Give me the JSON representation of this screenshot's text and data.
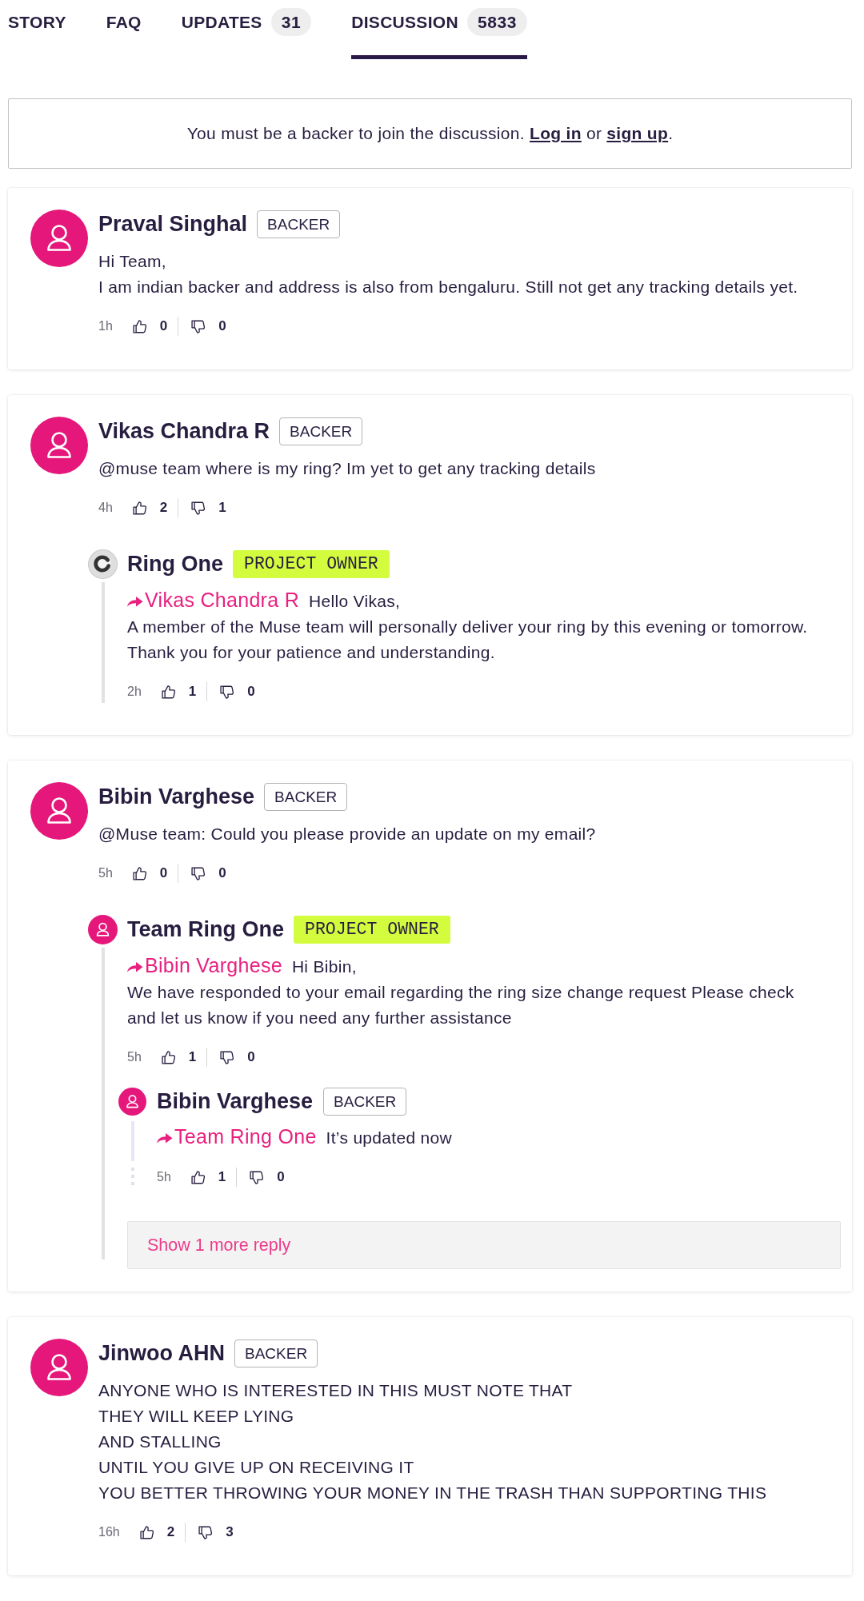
{
  "tabs": [
    {
      "label": "STORY",
      "selected": false
    },
    {
      "label": "FAQ",
      "selected": false
    },
    {
      "label": "UPDATES",
      "count": "31",
      "selected": false
    },
    {
      "label": "DISCUSSION",
      "count": "5833",
      "selected": true
    }
  ],
  "notice": {
    "parts": [
      {
        "kind": "text",
        "text": "You must be a backer to join the discussion. "
      },
      {
        "kind": "link",
        "text": "Log in"
      },
      {
        "kind": "text",
        "text": " or "
      },
      {
        "kind": "link",
        "text": "sign up"
      },
      {
        "kind": "text",
        "text": "."
      }
    ]
  },
  "comments": [
    {
      "author": "Praval Singhal",
      "avatar": {
        "kind": "user"
      },
      "badge": {
        "label": "BACKER",
        "kind": "backer"
      },
      "lines": [
        "Hi Team,",
        "I am indian backer and address is also from bengaluru. Still not get any tracking details yet."
      ],
      "time": "1h",
      "likes": "0",
      "dislikes": "0"
    },
    {
      "author": "Vikas Chandra R",
      "avatar": {
        "kind": "user"
      },
      "badge": {
        "label": "BACKER",
        "kind": "backer"
      },
      "lines": [
        "@muse team where is my ring? Im yet to get any tracking details"
      ],
      "time": "4h",
      "likes": "2",
      "dislikes": "1",
      "replies": [
        {
          "author": "Ring One",
          "avatar": {
            "kind": "logo"
          },
          "badge": {
            "label": "PROJECT OWNER",
            "kind": "owner"
          },
          "reply_to": "Vikas Chandra R",
          "lines": [
            "Hello Vikas,",
            "A member of the Muse team will personally deliver your ring by this evening or tomorrow.",
            "Thank you for your patience and understanding."
          ],
          "time": "2h",
          "likes": "1",
          "dislikes": "0"
        }
      ]
    },
    {
      "author": "Bibin Varghese",
      "avatar": {
        "kind": "user"
      },
      "badge": {
        "label": "BACKER",
        "kind": "backer"
      },
      "lines": [
        "@Muse team: Could you please provide an update on my email?"
      ],
      "time": "5h",
      "likes": "0",
      "dislikes": "0",
      "replies": [
        {
          "author": "Team Ring One",
          "avatar": {
            "kind": "user"
          },
          "badge": {
            "label": "PROJECT OWNER",
            "kind": "owner"
          },
          "reply_to": "Bibin Varghese",
          "lines": [
            "Hi Bibin,",
            "We have responded to your email regarding the ring size change request Please check",
            "and let us know if you need any further assistance"
          ],
          "time": "5h",
          "likes": "1",
          "dislikes": "0",
          "replies": [
            {
              "author": "Bibin Varghese",
              "avatar": {
                "kind": "user"
              },
              "badge": {
                "label": "BACKER",
                "kind": "backer"
              },
              "reply_to": "Team Ring One",
              "lines": [
                "It’s updated now"
              ],
              "time": "5h",
              "likes": "1",
              "dislikes": "0"
            }
          ],
          "more_replies": "Show 1 more reply"
        }
      ]
    },
    {
      "author": "Jinwoo AHN",
      "avatar": {
        "kind": "user"
      },
      "badge": {
        "label": "BACKER",
        "kind": "backer"
      },
      "lines": [
        "ANYONE WHO IS INTERESTED IN THIS MUST NOTE THAT",
        "THEY WILL KEEP LYING",
        "AND STALLING",
        "UNTIL YOU GIVE UP ON RECEIVING IT",
        "YOU BETTER THROWING YOUR MONEY IN THE TRASH THAN SUPPORTING THIS"
      ],
      "time": "16h",
      "likes": "2",
      "dislikes": "3"
    }
  ]
}
